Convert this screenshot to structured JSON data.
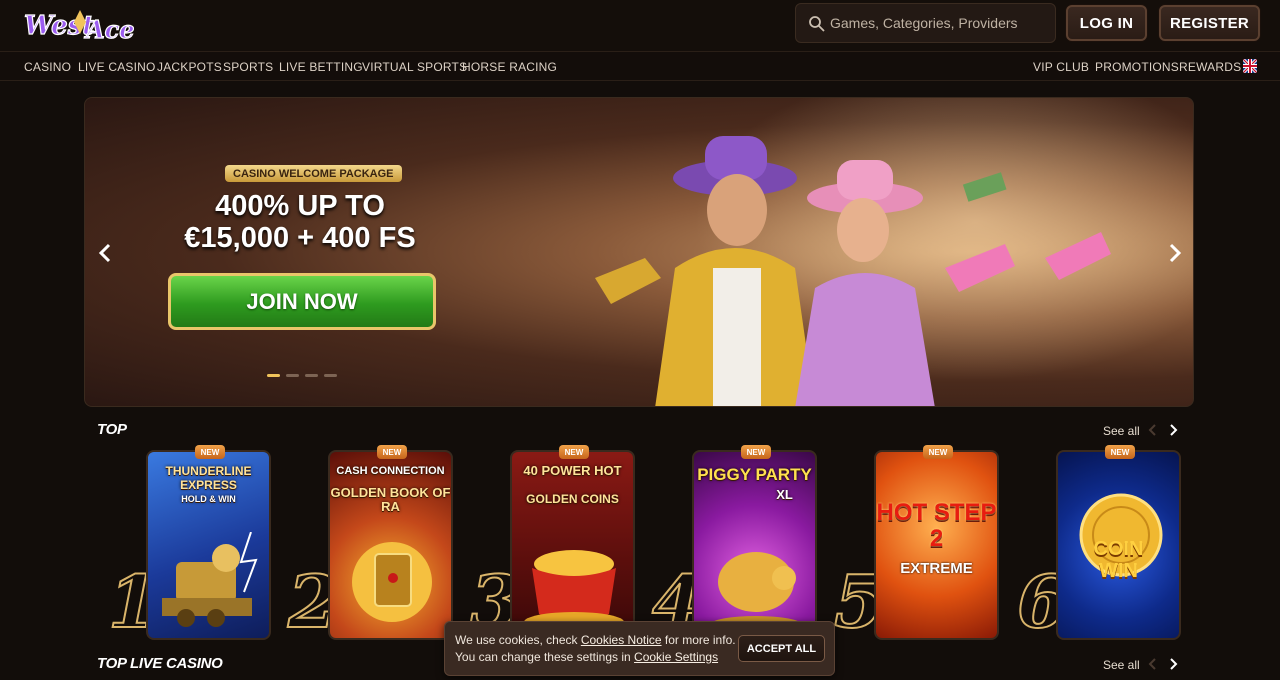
{
  "brand": {
    "logo_text": "West Ace",
    "accent": "#f0c35b",
    "purple": "#7a3fd1"
  },
  "search": {
    "placeholder": "Games, Categories, Providers",
    "icon": "search-icon"
  },
  "header": {
    "login_label": "LOG IN",
    "register_label": "REGISTER"
  },
  "nav_left": [
    "CASINO",
    "LIVE CASINO",
    "JACKPOTS",
    "SPORTS",
    "LIVE BETTING",
    "VIRTUAL SPORTS",
    "HORSE RACING"
  ],
  "nav_right": [
    "VIP CLUB",
    "PROMOTIONS",
    "REWARDS"
  ],
  "language": {
    "icon": "uk-flag-icon"
  },
  "hero": {
    "package_label": "CASINO WELCOME PACKAGE",
    "headline_1": "400% UP TO",
    "headline_2": "€15,000 + 400 FS",
    "cta": "JOIN NOW",
    "slides": 4,
    "active_slide": 1
  },
  "top_section": {
    "title": "TOP",
    "see_all": "See all",
    "games": [
      {
        "rank": "1",
        "badge": "NEW",
        "title": "THUNDERLINE EXPRESS",
        "subtitle": "HOLD & WIN",
        "color": "#1b3a9a"
      },
      {
        "rank": "2",
        "badge": "NEW",
        "title": "CASH CONNECTION",
        "subtitle": "GOLDEN BOOK OF RA",
        "color": "#8a1e12"
      },
      {
        "rank": "3",
        "badge": "NEW",
        "title": "40 POWER HOT",
        "subtitle": "GOLDEN COINS",
        "color": "#6a1410"
      },
      {
        "rank": "4",
        "badge": "NEW",
        "title": "PIGGY PARTY",
        "subtitle": "XL",
        "color": "#7a1a8a"
      },
      {
        "rank": "5",
        "badge": "NEW",
        "title": "HOT STEP 2",
        "subtitle": "EXTREME",
        "color": "#d8420e"
      },
      {
        "rank": "6",
        "badge": "NEW",
        "title": "COIN",
        "subtitle": "WIN",
        "color": "#0e2a8a"
      }
    ]
  },
  "live_section": {
    "title": "TOP LIVE CASINO",
    "see_all": "See all"
  },
  "cookie": {
    "text_1": "We use cookies, check ",
    "link_1": "Cookies Notice",
    "text_2": " for more info. You can change these settings in ",
    "link_2": "Cookie Settings",
    "accept": "ACCEPT ALL"
  }
}
